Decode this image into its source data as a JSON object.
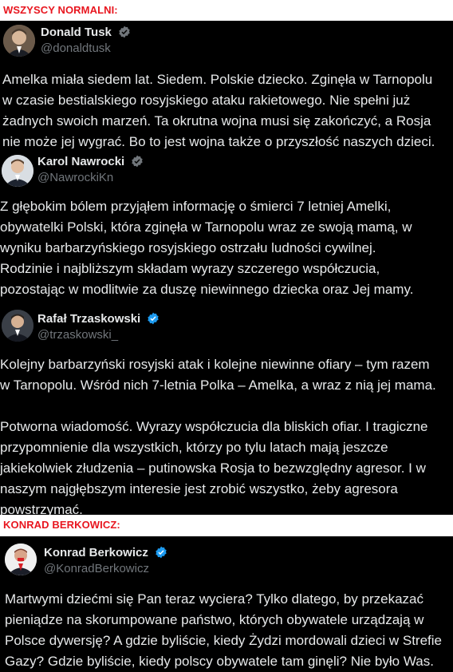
{
  "banner_top": {
    "label": "WSZYSCY NORMALNI:"
  },
  "banner_bottom": {
    "label": "KONRAD BERKOWICZ:"
  },
  "posts": [
    {
      "name": "Donald Tusk",
      "handle": "@donaldtusk",
      "verified_color": "#71767b",
      "lines": [
        "Amelka miała siedem lat. Siedem. Polskie dziecko. Zginęła w Tarnopolu",
        "w czasie bestialskiego rosyjskiego ataku rakietowego. Nie spełni już",
        "żadnych swoich marzeń. Ta okrutna wojna musi się zakończyć, a Rosja",
        "nie może jej wygrać. Bo to jest wojna także o przyszłość naszych dzieci."
      ]
    },
    {
      "name": "Karol Nawrocki",
      "handle": "@NawrockiKn",
      "verified_color": "#71767b",
      "lines": [
        "Z głębokim bólem przyjąłem informację o śmierci 7 letniej Amelki,",
        "obywatelki Polski, która zginęła w Tarnopolu wraz ze swoją mamą, w",
        "wyniku barbarzyńskiego rosyjskiego ostrzału ludności cywilnej.",
        "Rodzinie i najbliższym składam wyrazy szczerego współczucia,",
        "pozostając w modlitwie za duszę niewinnego dziecka oraz Jej mamy."
      ]
    },
    {
      "name": "Rafał Trzaskowski",
      "handle": "@trzaskowski_",
      "verified_color": "#1d9bf0",
      "lines": [
        "Kolejny barbarzyński rosyjski atak i kolejne niewinne ofiary – tym razem",
        "w Tarnopolu. Wśród nich 7-letnia Polka – Amelka, a wraz z nią jej mama."
      ],
      "lines2": [
        "Potworna wiadomość. Wyrazy współczucia dla bliskich ofiar. I tragiczne",
        "przypomnienie dla wszystkich, którzy po tylu latach mają jeszcze",
        "jakiekolwiek złudzenia – putinowska Rosja to bezwzględny agresor. I w",
        "naszym najgłębszym interesie jest zrobić wszystko, żeby agresora",
        "powstrzymać."
      ]
    },
    {
      "name": "Konrad Berkowicz",
      "handle": "@KonradBerkowicz",
      "verified_color": "#1d9bf0",
      "lines": [
        "Martwymi dziećmi się Pan teraz wyciera? Tylko dlatego, by przekazać",
        "pieniądze na skorumpowane państwo, których obywatele urządzają w",
        "Polsce dywersję? A gdzie byliście, kiedy Żydzi mordowali dzieci w Strefie",
        "Gazy? Gdzie byliście, kiedy polscy obywatele tam ginęli? Nie było Was."
      ]
    }
  ]
}
